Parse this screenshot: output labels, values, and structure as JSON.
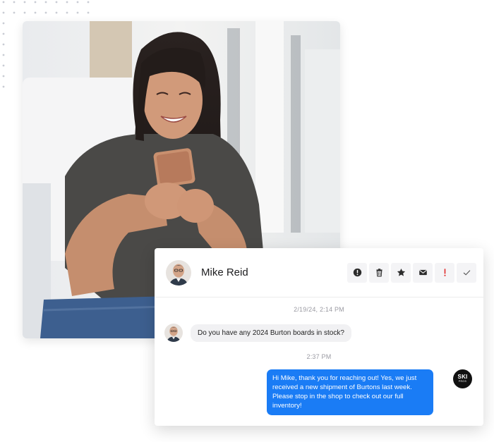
{
  "colors": {
    "accent_blue": "#1a7cf5",
    "bubble_gray": "#f1f1f3",
    "alert_red": "#e02b2b",
    "dot_gray": "#c9ccd4"
  },
  "photo": {
    "subject": "woman-smiling-at-phone"
  },
  "chat": {
    "contact_name": "Mike Reid",
    "toolbar": [
      {
        "icon": "alert-circle-icon"
      },
      {
        "icon": "trash-icon"
      },
      {
        "icon": "star-icon"
      },
      {
        "icon": "envelope-icon"
      },
      {
        "icon": "exclamation-icon"
      },
      {
        "icon": "check-icon"
      }
    ],
    "messages": [
      {
        "timestamp": "2/19/24, 2:14 PM",
        "direction": "incoming",
        "text": "Do you have any 2024 Burton boards in stock?"
      },
      {
        "timestamp": "2:37 PM",
        "direction": "outgoing",
        "text": "Hi Mike, thank you for reaching out! Yes, we just received a new shipment of Burtons last week. Please stop in the shop to check out our full inventory!"
      }
    ],
    "brand_badge": {
      "line1": "SKI",
      "line2": "PROS"
    }
  }
}
